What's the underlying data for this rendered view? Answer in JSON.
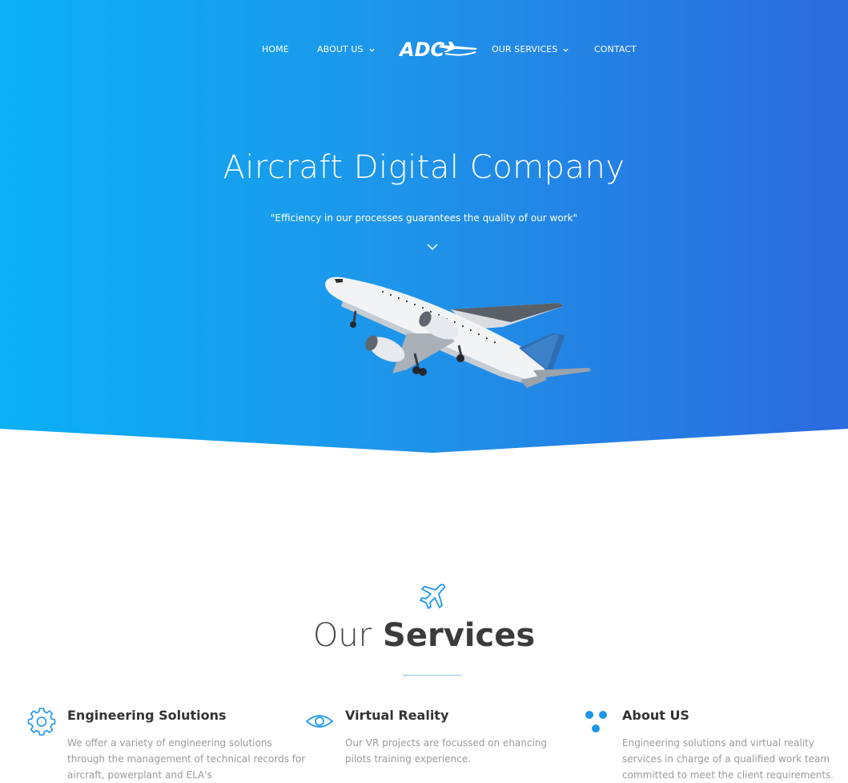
{
  "nav": {
    "home": "HOME",
    "about": "ABOUT US",
    "logo_text": "ADC",
    "services": "OUR SERVICES",
    "contact": "CONTACT"
  },
  "hero": {
    "title": "Aircraft Digital Company",
    "subtitle": "\"Efficiency in our processes guarantees the quality of our work\""
  },
  "services": {
    "title_light": "Our",
    "title_bold": "Services",
    "items": [
      {
        "icon": "gear-icon",
        "title": "Engineering Solutions",
        "text": "We offer a variety of engineering solutions through the management of technical records for aircraft, powerplant and ELA's"
      },
      {
        "icon": "eye-icon",
        "title": "Virtual Reality",
        "text": "Our VR projects are focussed on ehancing pilots training experience."
      },
      {
        "icon": "dots-icon",
        "title": "About US",
        "text": "Engineering solutions and virtual reality services in charge of a qualified work team committed to meet the client requirements."
      }
    ]
  },
  "colors": {
    "gradient_start": "#0bb0f5",
    "gradient_end": "#2c6ade",
    "accent": "#1d96ea",
    "heading": "#333333",
    "body_text": "#9a9a9a"
  }
}
